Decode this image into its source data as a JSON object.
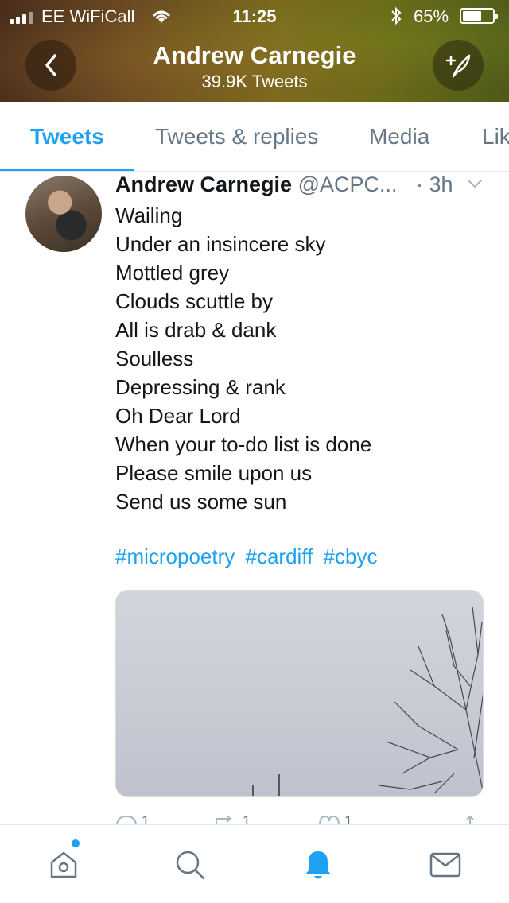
{
  "status_bar": {
    "carrier": "EE WiFiCall",
    "time": "11:25",
    "battery": "65%",
    "battery_level": 0.65
  },
  "header": {
    "name": "Andrew Carnegie",
    "tweet_count": "39.9K Tweets",
    "back_icon": "chevron-left-icon",
    "compose_icon": "compose-feather-icon"
  },
  "tabs": [
    {
      "label": "Tweets",
      "active": true
    },
    {
      "label": "Tweets & replies",
      "active": false
    },
    {
      "label": "Media",
      "active": false
    },
    {
      "label": "Lik",
      "active": false
    }
  ],
  "tweet": {
    "author": "Andrew Carnegie",
    "handle": "@ACPC...",
    "time": "· 3h",
    "lines": [
      "Wailing",
      "Under an insincere sky",
      "Mottled grey",
      "Clouds scuttle by",
      "All is drab & dank",
      "Soulless",
      "Depressing & rank",
      "Oh Dear Lord",
      "When your to-do list is done",
      "Please smile upon us",
      "Send us some sun"
    ],
    "hashtags": [
      "#micropoetry",
      "#cardiff",
      "#cbyc"
    ],
    "actions": {
      "replies": "1",
      "retweets": "1",
      "likes": "1"
    }
  },
  "bottom_nav": [
    {
      "icon": "home-icon",
      "has_notification_dot": true
    },
    {
      "icon": "search-icon"
    },
    {
      "icon": "bell-icon",
      "active": true
    },
    {
      "icon": "mail-icon"
    }
  ],
  "colors": {
    "accent": "#1da1f2",
    "text": "#14171a",
    "secondary": "#657786"
  }
}
